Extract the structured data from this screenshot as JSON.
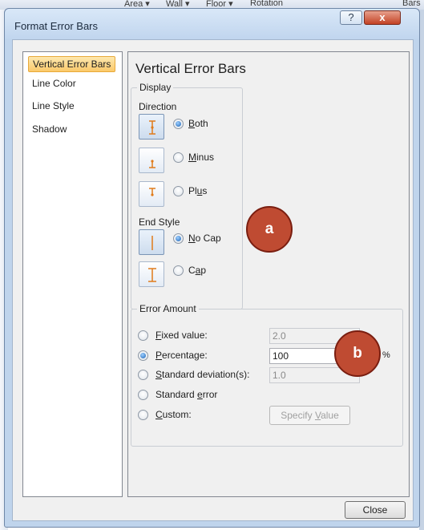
{
  "background": {
    "toolbar_items": [
      "Area ▾",
      "Wall ▾",
      "Floor ▾",
      "Rotation",
      "Bars"
    ]
  },
  "dialog": {
    "title": "Format Error Bars",
    "help_button": "?",
    "close_x": "x"
  },
  "nav": {
    "items": [
      {
        "label": "Vertical Error Bars",
        "selected": true
      },
      {
        "label": "Line Color",
        "selected": false
      },
      {
        "label": "Line Style",
        "selected": false
      },
      {
        "label": "Shadow",
        "selected": false
      }
    ]
  },
  "panel": {
    "title": "Vertical Error Bars",
    "display": {
      "group_label": "Display",
      "direction_label": "Direction",
      "direction_options": [
        {
          "pre": "",
          "u": "B",
          "post": "oth",
          "checked": true
        },
        {
          "pre": "",
          "u": "M",
          "post": "inus",
          "checked": false
        },
        {
          "pre": "Pl",
          "u": "u",
          "post": "s",
          "checked": false
        }
      ],
      "end_style_label": "End Style",
      "end_style_options": [
        {
          "pre": "",
          "u": "N",
          "post": "o Cap",
          "checked": true
        },
        {
          "pre": "C",
          "u": "a",
          "post": "p",
          "checked": false
        }
      ]
    },
    "error_amount": {
      "group_label": "Error Amount",
      "options": [
        {
          "pre": "",
          "u": "F",
          "post": "ixed value:",
          "checked": false
        },
        {
          "pre": "",
          "u": "P",
          "post": "ercentage:",
          "checked": true
        },
        {
          "pre": "",
          "u": "S",
          "post": "tandard deviation(s):",
          "checked": false
        },
        {
          "pre": "Standard ",
          "u": "e",
          "post": "rror",
          "checked": false
        },
        {
          "pre": "",
          "u": "C",
          "post": "ustom:",
          "checked": false
        }
      ],
      "fixed_value": "2.0",
      "percentage_value": "100",
      "percent_symbol": "%",
      "std_dev_value": "1.0",
      "specify_value_button": {
        "pre": "Specify ",
        "u": "V",
        "post": "alue"
      }
    }
  },
  "close_button": "Close",
  "annotations": {
    "a": "a",
    "b": "b"
  },
  "colors": {
    "annotation_fill": "#bf4b32",
    "selected_nav": "#fbc96a",
    "icon_orange": "#e07b1a"
  }
}
